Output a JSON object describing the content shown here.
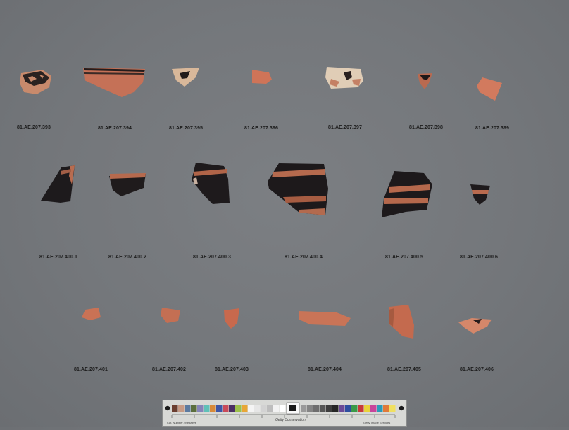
{
  "fragments": [
    {
      "id": "a393",
      "label": "81.AE.207.393"
    },
    {
      "id": "a394",
      "label": "81.AE.207.394"
    },
    {
      "id": "a395",
      "label": "81.AE.207.395"
    },
    {
      "id": "a396",
      "label": "81.AE.207.396"
    },
    {
      "id": "a397",
      "label": "81.AE.207.397"
    },
    {
      "id": "a398",
      "label": "81.AE.207.398"
    },
    {
      "id": "a399",
      "label": "81.AE.207.399"
    },
    {
      "id": "a4001",
      "label": "81.AE.207.400.1"
    },
    {
      "id": "a4002",
      "label": "81.AE.207.400.2"
    },
    {
      "id": "a4003",
      "label": "81.AE.207.400.3"
    },
    {
      "id": "a4004",
      "label": "81.AE.207.400.4"
    },
    {
      "id": "a4005",
      "label": "81.AE.207.400.5"
    },
    {
      "id": "a4006",
      "label": "81.AE.207.400.6"
    },
    {
      "id": "a401",
      "label": "81.AE.207.401"
    },
    {
      "id": "a402",
      "label": "81.AE.207.402"
    },
    {
      "id": "a403",
      "label": "81.AE.207.403"
    },
    {
      "id": "a404",
      "label": "81.AE.207.404"
    },
    {
      "id": "a405",
      "label": "81.AE.207.405"
    },
    {
      "id": "a406",
      "label": "81.AE.207.406"
    }
  ],
  "color_card": {
    "label": "Getty Conservation",
    "left_text": "Cat. Number / Negative",
    "right_text": "Getty Image Services"
  },
  "colors": {
    "background": "#74777b",
    "terracotta": "#c8745a",
    "black_glaze": "#1e1a1c",
    "label_text": "#1c1c1c"
  }
}
